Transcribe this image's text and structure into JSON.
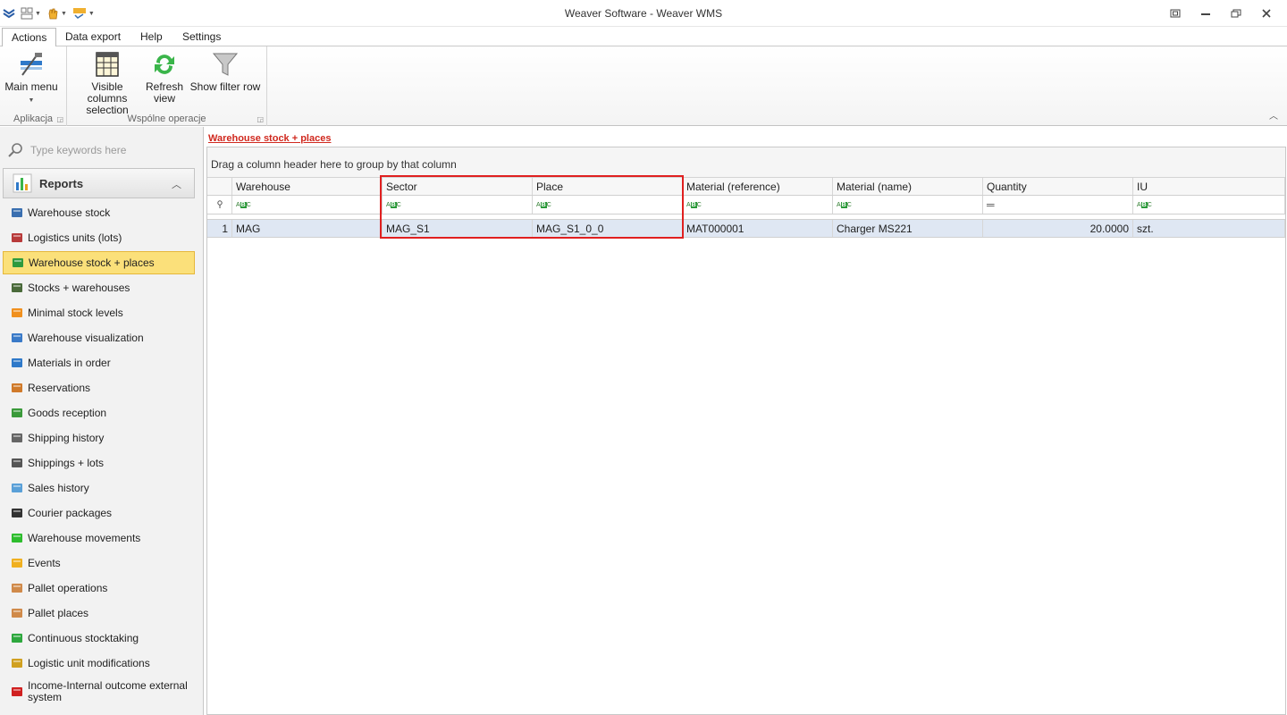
{
  "window": {
    "title": "Weaver Software - Weaver WMS"
  },
  "tabs": [
    {
      "label": "Actions",
      "active": true
    },
    {
      "label": "Data export",
      "active": false
    },
    {
      "label": "Help",
      "active": false
    },
    {
      "label": "Settings",
      "active": false
    }
  ],
  "ribbon": {
    "groups": [
      {
        "label": "Aplikacja",
        "buttons": [
          {
            "label": "Main menu",
            "icon": "main-menu-icon"
          }
        ]
      },
      {
        "label": "Wspólne operacje",
        "buttons": [
          {
            "label": "Visible columns selection",
            "icon": "columns-icon"
          },
          {
            "label": "Refresh view",
            "icon": "refresh-icon"
          },
          {
            "label": "Show filter row",
            "icon": "filter-icon"
          }
        ]
      }
    ]
  },
  "sidebar": {
    "search_placeholder": "Type keywords here",
    "section": "Reports",
    "items": [
      {
        "label": "Warehouse stock",
        "icon": "warehouse-icon",
        "color": "#3a6fb0"
      },
      {
        "label": "Logistics units (lots)",
        "icon": "lots-icon",
        "color": "#b83a3a"
      },
      {
        "label": "Warehouse stock + places",
        "icon": "stock-places-icon",
        "color": "#2e9a3e",
        "selected": true
      },
      {
        "label": "Stocks + warehouses",
        "icon": "truck-icon",
        "color": "#4a6a3a"
      },
      {
        "label": "Minimal stock levels",
        "icon": "arrow-down-icon",
        "color": "#f0901e"
      },
      {
        "label": "Warehouse visualization",
        "icon": "map-icon",
        "color": "#3a7ac8"
      },
      {
        "label": "Materials in order",
        "icon": "flag-icon",
        "color": "#2f79c9"
      },
      {
        "label": "Reservations",
        "icon": "reservation-icon",
        "color": "#d07a2a"
      },
      {
        "label": "Goods reception",
        "icon": "reception-truck-icon",
        "color": "#3a9a3a"
      },
      {
        "label": "Shipping history",
        "icon": "shipping-icon",
        "color": "#666666"
      },
      {
        "label": "Shippings + lots",
        "icon": "shipping-lots-icon",
        "color": "#555555"
      },
      {
        "label": "Sales history",
        "icon": "sales-icon",
        "color": "#5aa0d8"
      },
      {
        "label": "Courier packages",
        "icon": "plane-icon",
        "color": "#333333"
      },
      {
        "label": "Warehouse movements",
        "icon": "arrow-right-icon",
        "color": "#2ebd2e"
      },
      {
        "label": "Events",
        "icon": "lightning-icon",
        "color": "#f0b020"
      },
      {
        "label": "Pallet operations",
        "icon": "pallet-icon",
        "color": "#d08a4a"
      },
      {
        "label": "Pallet places",
        "icon": "pallet-place-icon",
        "color": "#d08a4a"
      },
      {
        "label": "Continuous stocktaking",
        "icon": "cycle-icon",
        "color": "#2ea83e"
      },
      {
        "label": "Logistic unit modifications",
        "icon": "unit-mod-icon",
        "color": "#d0a020"
      },
      {
        "label": "Income-Internal outcome external system",
        "icon": "exchange-icon",
        "color": "#d02020"
      }
    ]
  },
  "content": {
    "breadcrumb": "Warehouse stock + places",
    "group_panel": "Drag a column header here to group by that column",
    "columns": [
      "Warehouse",
      "Sector",
      "Place",
      "Material (reference)",
      "Material (name)",
      "Quantity",
      "IU"
    ],
    "filter_icons": [
      "abc",
      "abc",
      "abc",
      "abc",
      "abc",
      "equals",
      "abc"
    ],
    "rows": [
      {
        "index": "1",
        "cells": [
          "MAG",
          "MAG_S1",
          "MAG_S1_0_0",
          "MAT000001",
          "Charger MS221",
          "20.0000",
          "szt."
        ]
      }
    ]
  }
}
